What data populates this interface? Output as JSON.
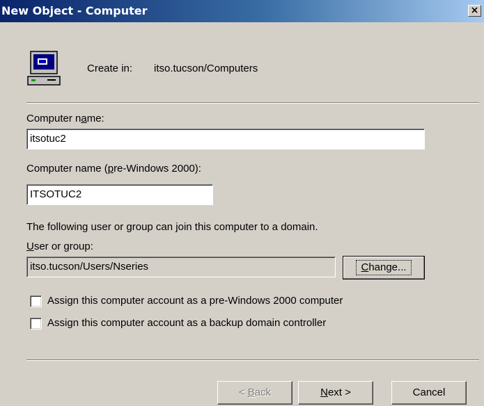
{
  "window": {
    "title": "New Object - Computer",
    "close_glyph": "×"
  },
  "header": {
    "icon": "computer-icon",
    "create_in_label": "Create in:",
    "create_in_path": "itso.tucson/Computers"
  },
  "computer_name": {
    "label_pre": "Computer n",
    "label_u": "a",
    "label_post": "me:",
    "value": "itsotuc2"
  },
  "computer_name_pre2000": {
    "label_pre": "Computer name (",
    "label_u": "p",
    "label_post": "re-Windows 2000):",
    "value": "ITSOTUC2"
  },
  "join_text": "The following user or group can join this computer to a domain.",
  "user_or_group": {
    "label_u": "U",
    "label_post": "ser or group:",
    "value": "itso.tucson/Users/Nseries",
    "change_u": "C",
    "change_post": "hange..."
  },
  "checkboxes": [
    {
      "pre": "Assign this computer account as a pre-Windows 2000 computer",
      "u": "",
      "post": "",
      "checked": false
    },
    {
      "pre": "Assi",
      "u": "g",
      "post": "n this computer account as a backup domain controller",
      "checked": false
    }
  ],
  "buttons": {
    "back_pre": "< ",
    "back_u": "B",
    "back_post": "ack",
    "next_u": "N",
    "next_post": "ext >",
    "cancel": "Cancel"
  }
}
